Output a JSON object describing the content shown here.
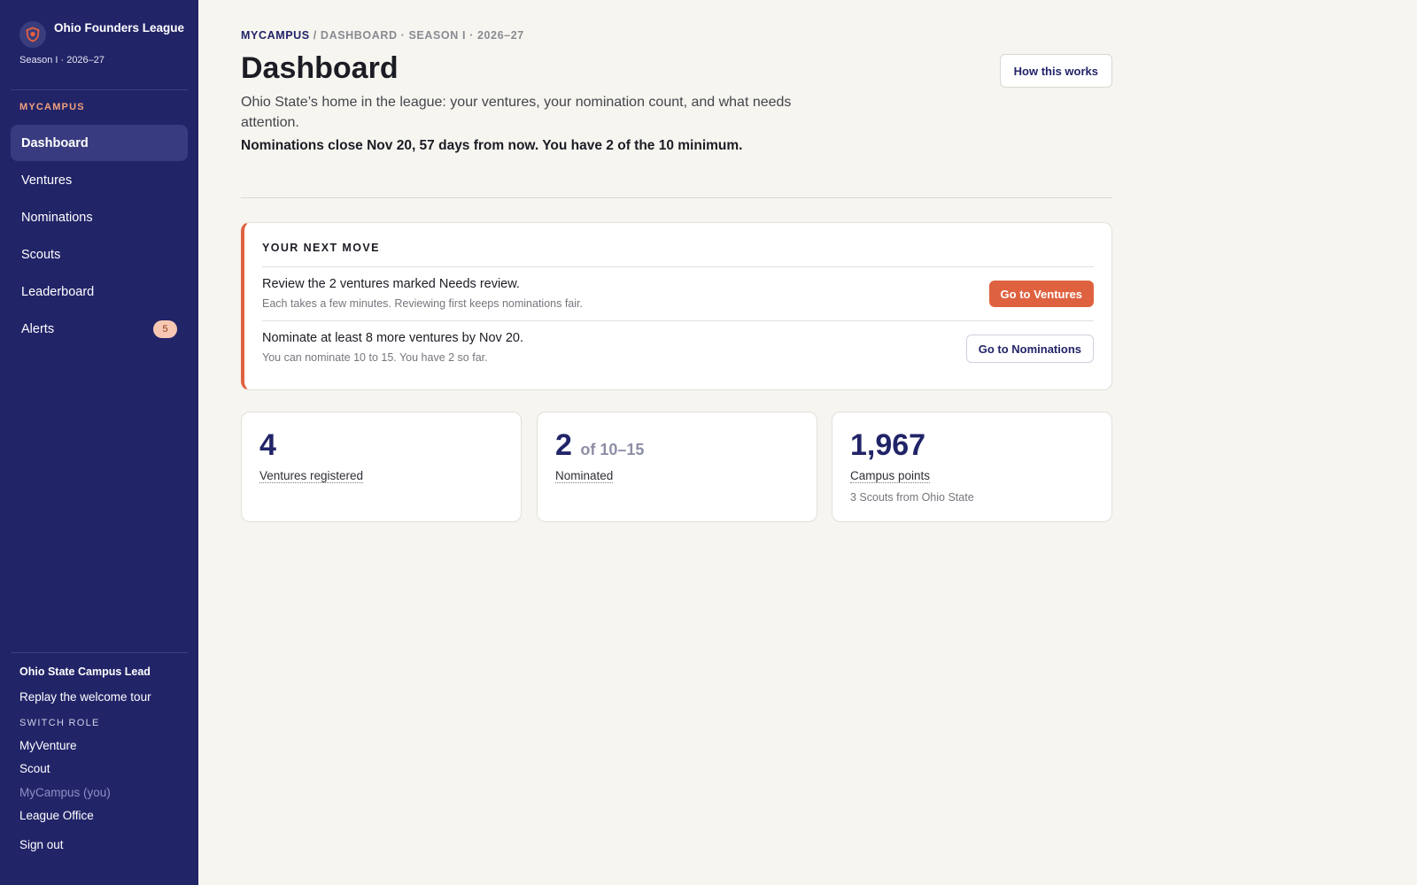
{
  "sidebar": {
    "brand_name": "Ohio Founders League",
    "season": "Season I · 2026–27",
    "section_label": "MYCAMPUS",
    "items": [
      {
        "label": "Dashboard",
        "active": true
      },
      {
        "label": "Ventures"
      },
      {
        "label": "Nominations"
      },
      {
        "label": "Scouts"
      },
      {
        "label": "Leaderboard"
      },
      {
        "label": "Alerts",
        "badge": "5"
      }
    ],
    "user_role": "Ohio State Campus Lead",
    "replay_tour": "Replay the welcome tour",
    "switch_role_label": "SWITCH ROLE",
    "roles": [
      "MyVenture",
      "Scout",
      "MyCampus (you)",
      "League Office"
    ],
    "sign_out": "Sign out"
  },
  "breadcrumb": {
    "root": "MYCAMPUS",
    "rest": " / DASHBOARD · SEASON I · 2026–27"
  },
  "header": {
    "title": "Dashboard",
    "help_button": "How this works",
    "intro": "Ohio State’s home in the league: your ventures, your nomination count, and what needs attention.",
    "deadline": "Nominations close Nov 20, 57 days from now. You have 2 of the 10 minimum."
  },
  "next_move": {
    "title": "YOUR NEXT MOVE",
    "rows": [
      {
        "main": "Review the 2 ventures marked Needs review.",
        "sub": "Each takes a few minutes. Reviewing first keeps nominations fair.",
        "button": "Go to Ventures"
      },
      {
        "main": "Nominate at least 8 more ventures by Nov 20.",
        "sub": "You can nominate 10 to 15. You have 2 so far.",
        "button": "Go to Nominations"
      }
    ]
  },
  "stats": [
    {
      "value": "4",
      "label": "Ventures registered"
    },
    {
      "value": "2",
      "suffix": "of 10–15",
      "label": "Nominated"
    },
    {
      "value": "1,967",
      "label": "Campus points",
      "sub": "3 Scouts from Ohio State"
    }
  ],
  "colors": {
    "sidebar_bg": "#222468",
    "accent": "#df6240",
    "page_bg": "#f6f5f0"
  }
}
